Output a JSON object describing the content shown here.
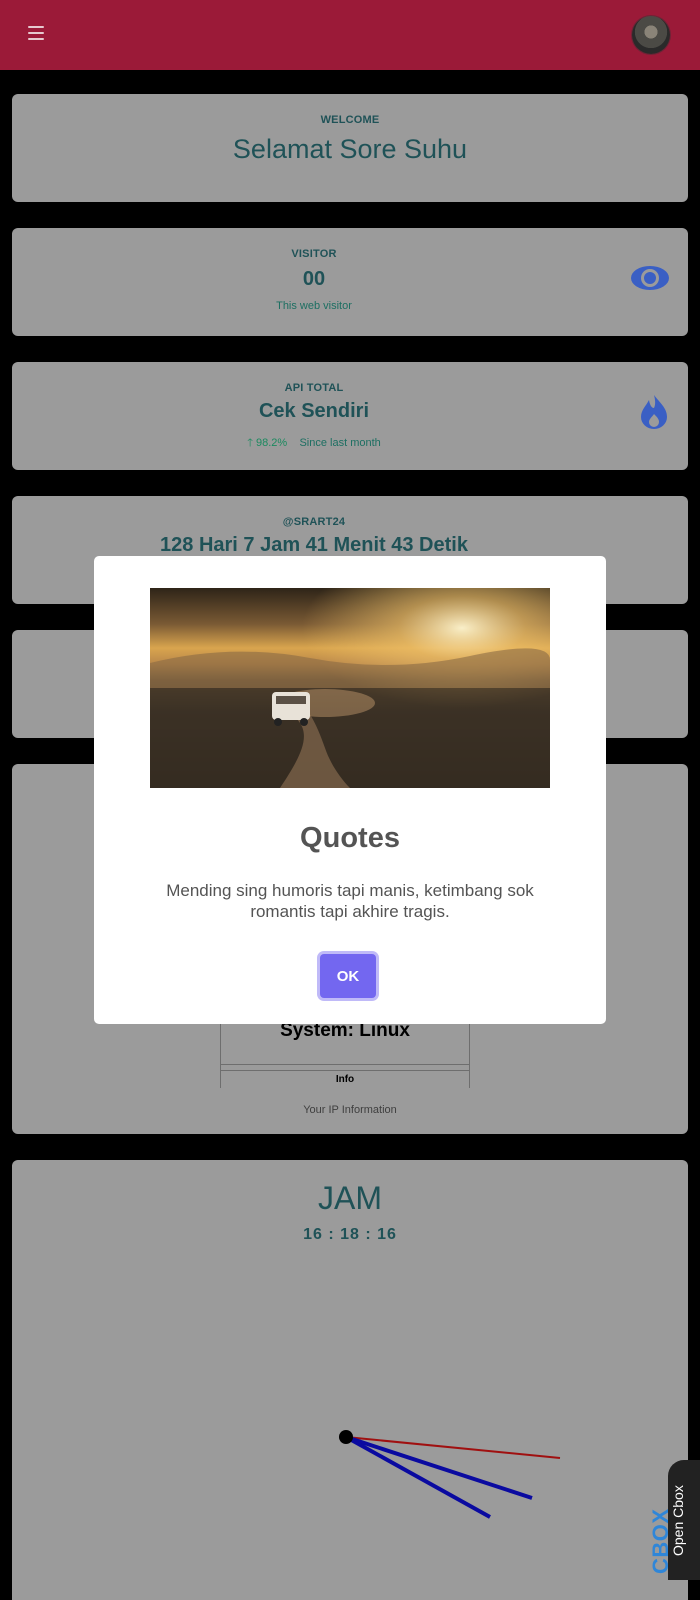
{
  "header": {
    "menu_icon": "hamburger-menu-icon",
    "avatar_icon": "user-avatar"
  },
  "welcome": {
    "eyebrow": "WELCOME",
    "greeting": "Selamat Sore Suhu"
  },
  "visitor": {
    "eyebrow": "VISITOR",
    "count": "00",
    "caption": "This web visitor",
    "icon": "eye-icon"
  },
  "api_total": {
    "eyebrow": "API TOTAL",
    "value": "Cek Sendiri",
    "delta": "98.2%",
    "delta_caption": "Since last month",
    "icon": "flame-icon"
  },
  "uptime": {
    "eyebrow": "@SRART24",
    "value": "128 Hari 7 Jam 41 Menit 43 Detik"
  },
  "ip_info": {
    "system": "System: Linux",
    "table_header": "Info",
    "caption": "Your IP Information"
  },
  "clock": {
    "title": "JAM",
    "time": "16 : 18 : 16",
    "hand_colors": {
      "second": "#a01010",
      "minute": "#0a0aa0",
      "hour": "#0a0aa0"
    }
  },
  "modal": {
    "title": "Quotes",
    "text": "Mending sing humoris tapi manis, ketimbang sok romantis tapi akhire tragis.",
    "ok_label": "OK"
  },
  "cbox": {
    "label": "Open Cbox",
    "logo": "CBOX"
  },
  "colors": {
    "topbar": "#9b1a38",
    "card": "#9b9b9b",
    "accent_text": "#1f5257",
    "button": "#7367f0"
  }
}
